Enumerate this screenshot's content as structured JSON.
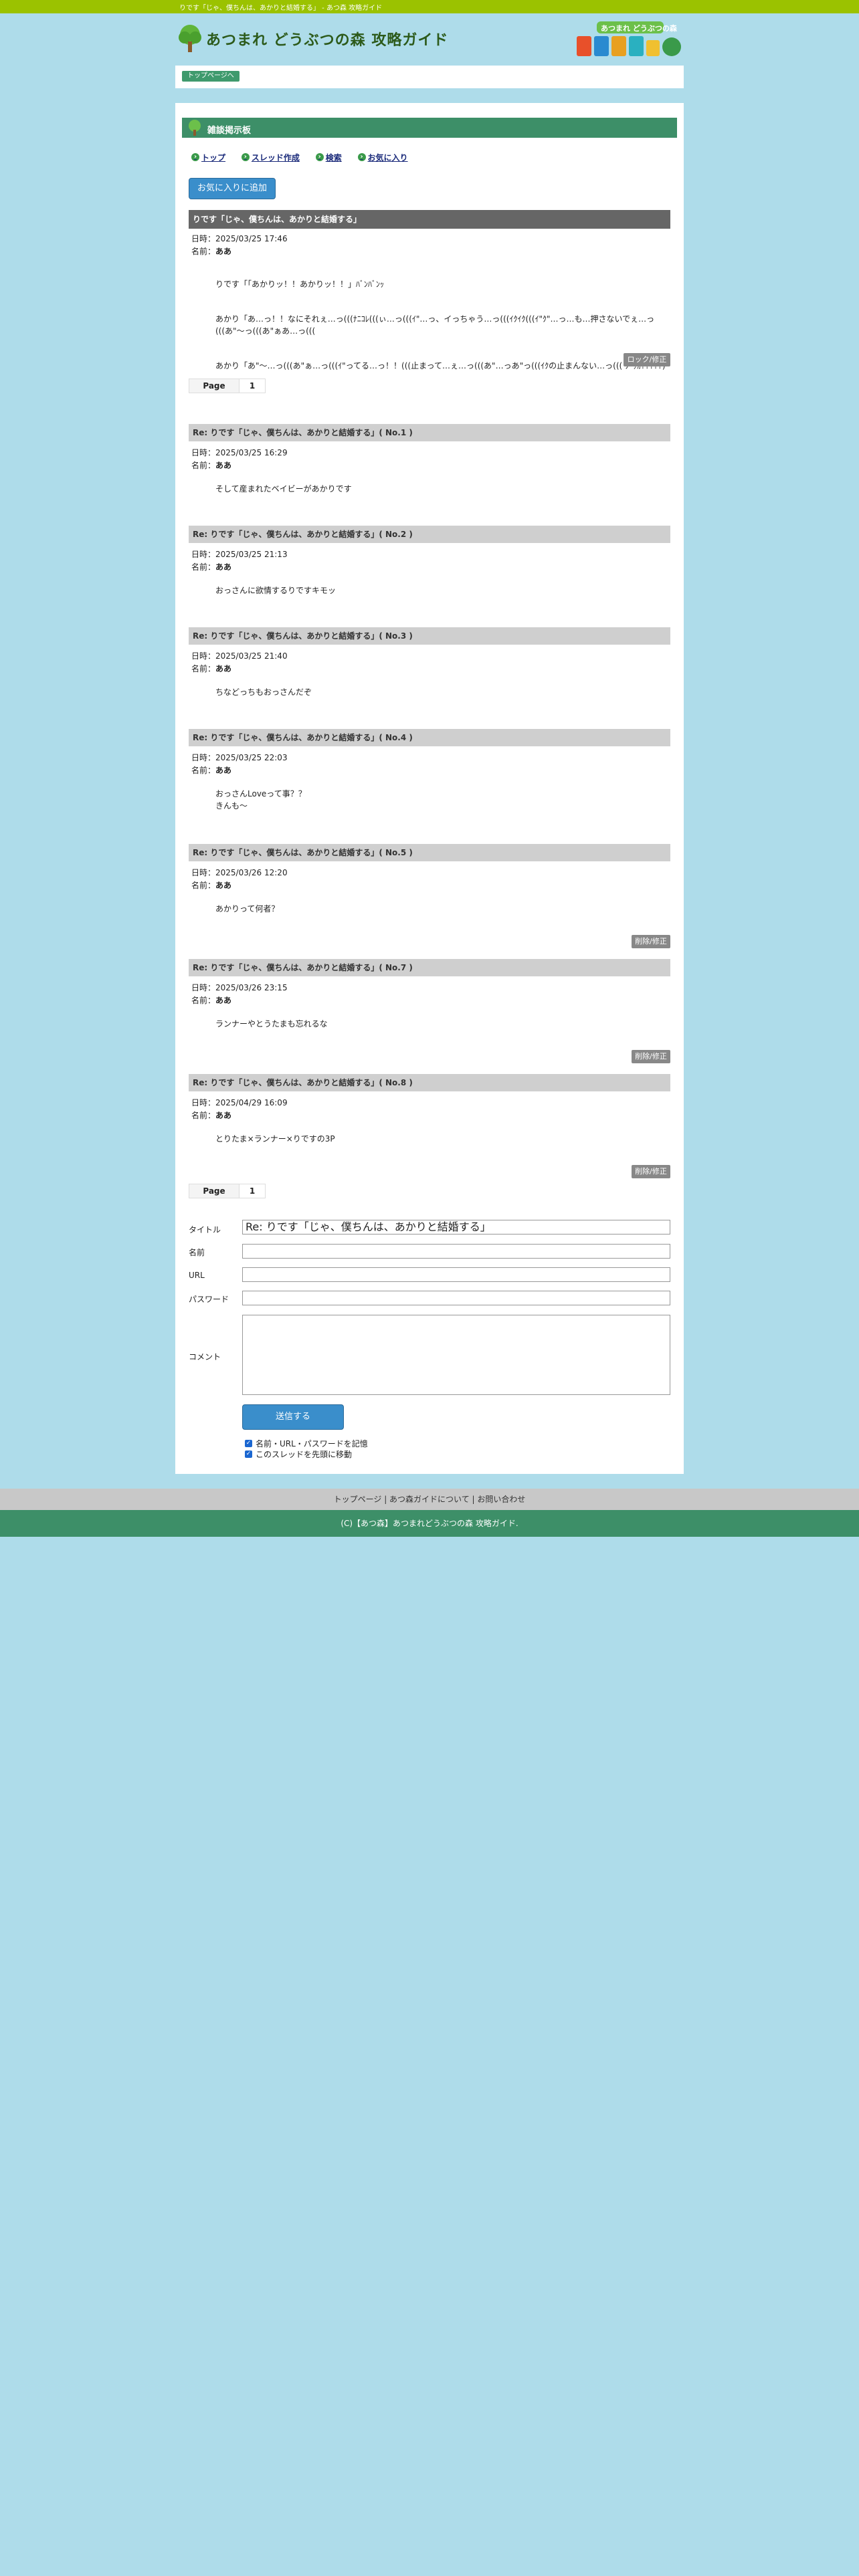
{
  "window": {
    "title_bar": "りです「じゃ、僕ちんは、あかりと結婚する」 - あつ森 攻略ガイド"
  },
  "header": {
    "logo_text": "あつまれ どうぶつの森 攻略ガイド",
    "badge_text": "あつまれ どうぶつの森"
  },
  "breadcrumb": {
    "top_label": "トップページへ"
  },
  "board": {
    "heading": "雑談掲示板"
  },
  "nav": {
    "items": [
      "トップ",
      "スレッド作成",
      "検索",
      "お気に入り"
    ]
  },
  "fav_button": "お気に入りに追加",
  "thread": {
    "title": "りです「じゃ、僕ちんは、あかりと結婚する」",
    "date_label": "日時：",
    "date": "2025/03/25 17:46",
    "name_label": "名前：",
    "name": "ああ",
    "body_lines": [
      "りです「「あかりッ！！あかりッ！！」ﾊﾞﾝﾊﾞﾝｯ",
      "あかり「あ…っ！！なにそれぇ…っ(((ﾅﾆｺﾚ(((ぃ…っ(((ｲ\"…っ、イっちゃう…っ(((ｲｸｲｸ(((ｲ\"ｸ\"…っ…も…押さないでぇ…っ(((あ\"〜っ(((あ\"ぁあ…っ(((",
      "あかり「あ\"〜…っ(((あ\"ぁ…っ(((ｲ\"ってる…っ！！(((止まって…ぇ…っ(((あ\"…っあ\"っ(((ｲｸの止まんない…っ((( ﾌﾞｯｶ?????)"
    ],
    "lock_button": "ロック/修正"
  },
  "pager": {
    "label": "Page",
    "pages": [
      "1"
    ]
  },
  "replies": [
    {
      "title": "Re: りです「じゃ、僕ちんは、あかりと結婚する」( No.1 )",
      "date": "2025/03/25 16:29",
      "name": "ああ",
      "body": "そして産まれたベイビーがあかりです",
      "edit": ""
    },
    {
      "title": "Re: りです「じゃ、僕ちんは、あかりと結婚する」( No.2 )",
      "date": "2025/03/25 21:13",
      "name": "ああ",
      "body": "おっさんに欲情するりですキモッ",
      "edit": ""
    },
    {
      "title": "Re: りです「じゃ、僕ちんは、あかりと結婚する」( No.3 )",
      "date": "2025/03/25 21:40",
      "name": "ああ",
      "body": "ちなどっちもおっさんだぞ",
      "edit": ""
    },
    {
      "title": "Re: りです「じゃ、僕ちんは、あかりと結婚する」( No.4 )",
      "date": "2025/03/25 22:03",
      "name": "ああ",
      "body": "おっさんLoveって事？？\nきんも〜",
      "edit": ""
    },
    {
      "title": "Re: りです「じゃ、僕ちんは、あかりと結婚する」( No.5 )",
      "date": "2025/03/26 12:20",
      "name": "ああ",
      "body": "あかりって何者？",
      "edit": "削除/修正"
    },
    {
      "title": "Re: りです「じゃ、僕ちんは、あかりと結婚する」( No.7 )",
      "date": "2025/03/26 23:15",
      "name": "ああ",
      "body": "ランナーやとうたまも忘れるな",
      "edit": "削除/修正"
    },
    {
      "title": "Re: りです「じゃ、僕ちんは、あかりと結婚する」( No.8 )",
      "date": "2025/04/29 16:09",
      "name": "ああ",
      "body": "とりたま×ランナー×りですの3P",
      "edit": "削除/修正"
    }
  ],
  "form": {
    "title_label": "タイトル",
    "title_value": "Re: りです「じゃ、僕ちんは、あかりと結婚する」",
    "name_label": "名前",
    "url_label": "URL",
    "password_label": "パスワード",
    "comment_label": "コメント",
    "send_button": "送信する",
    "check1": "名前・URL・パスワードを記憶",
    "check2": "このスレッドを先頭に移動"
  },
  "footer": {
    "links": "トップページ | あつ森ガイドについて | お問い合わせ",
    "copyright": "(C)【あつ森】あつまれどうぶつの森 攻略ガイド."
  },
  "colors": {
    "topbar": "#9bc200",
    "board_head": "#3d8f68",
    "button_blue": "#3a8ecb",
    "background": "#aedcea"
  }
}
